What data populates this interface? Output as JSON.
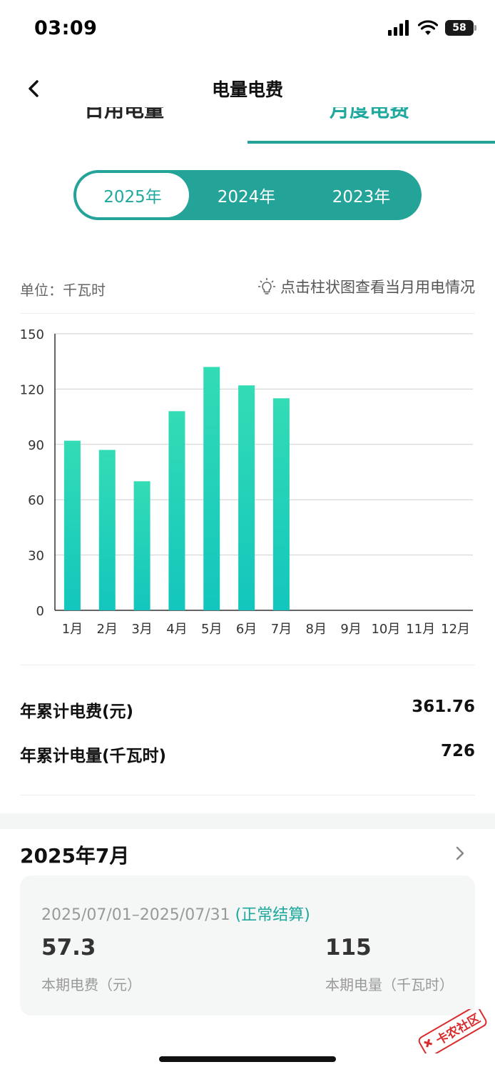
{
  "status_bar": {
    "time": "03:09",
    "battery": "58"
  },
  "header": {
    "title": "电量电费"
  },
  "tabs": [
    {
      "label": "日用电量",
      "active": false
    },
    {
      "label": "月度电费",
      "active": true
    }
  ],
  "years": [
    {
      "label": "2025年",
      "active": true
    },
    {
      "label": "2024年",
      "active": false
    },
    {
      "label": "2023年",
      "active": false
    }
  ],
  "chart_info": {
    "unit_text": "单位：千瓦时",
    "hint_text": "点击柱状图查看当月用电情况"
  },
  "chart_data": {
    "type": "bar",
    "categories": [
      "1月",
      "2月",
      "3月",
      "4月",
      "5月",
      "6月",
      "7月",
      "8月",
      "9月",
      "10月",
      "11月",
      "12月"
    ],
    "values": [
      92,
      87,
      70,
      108,
      132,
      122,
      115,
      null,
      null,
      null,
      null,
      null
    ],
    "yticks": [
      0,
      30,
      60,
      90,
      120,
      150
    ],
    "ylim": [
      0,
      150
    ],
    "grid": true,
    "bar_color_top": "#33dcb5",
    "bar_color_bottom": "#13c6bd"
  },
  "summary": {
    "fee_label": "年累计电费(元)",
    "fee_value": "361.76",
    "energy_label": "年累计电量(千瓦时)",
    "energy_value": "726"
  },
  "month_card": {
    "title": "2025年7月",
    "period": "2025/07/01–2025/07/31",
    "status": "(正常结算)",
    "fee_value": "57.3",
    "fee_label": "本期电费（元）",
    "energy_value": "115",
    "energy_label": "本期电量（千瓦时）"
  },
  "watermark": {
    "text": "卡农社区"
  },
  "colors": {
    "accent": "#24a399",
    "accent_text": "#1fa89e"
  }
}
